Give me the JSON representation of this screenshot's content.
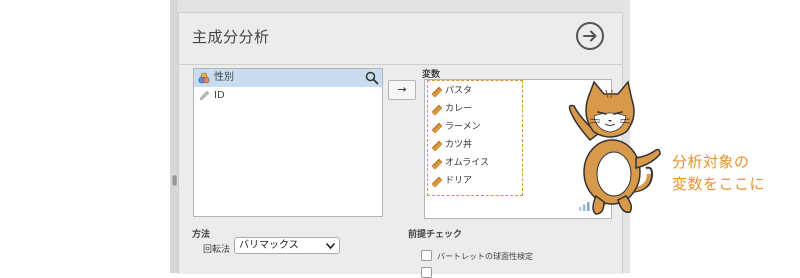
{
  "window": {
    "title": "主成分分析"
  },
  "source_list": {
    "items": [
      {
        "label": "性別",
        "icon": "nominal-venn-icon",
        "selected": true
      },
      {
        "label": "ID",
        "icon": "id-pencil-icon",
        "selected": false
      }
    ]
  },
  "move_button": {
    "label": "→"
  },
  "variables": {
    "label": "変数",
    "items": [
      "パスタ",
      "カレー",
      "ラーメン",
      "カツ丼",
      "オムライス",
      "ドリア"
    ]
  },
  "method": {
    "label": "方法",
    "rotation_label": "回転法",
    "rotation_value": "バリマックス"
  },
  "precheck": {
    "label": "前提チェック",
    "options": [
      {
        "label": "バートレットの球面性検定",
        "checked": false
      }
    ]
  },
  "annotation": {
    "line1": "分析対象の",
    "line2": "変数をここに"
  },
  "colors": {
    "accent": "#e8922a",
    "selection": "#c9dcf0",
    "ruler_icon": "#e0a040"
  }
}
